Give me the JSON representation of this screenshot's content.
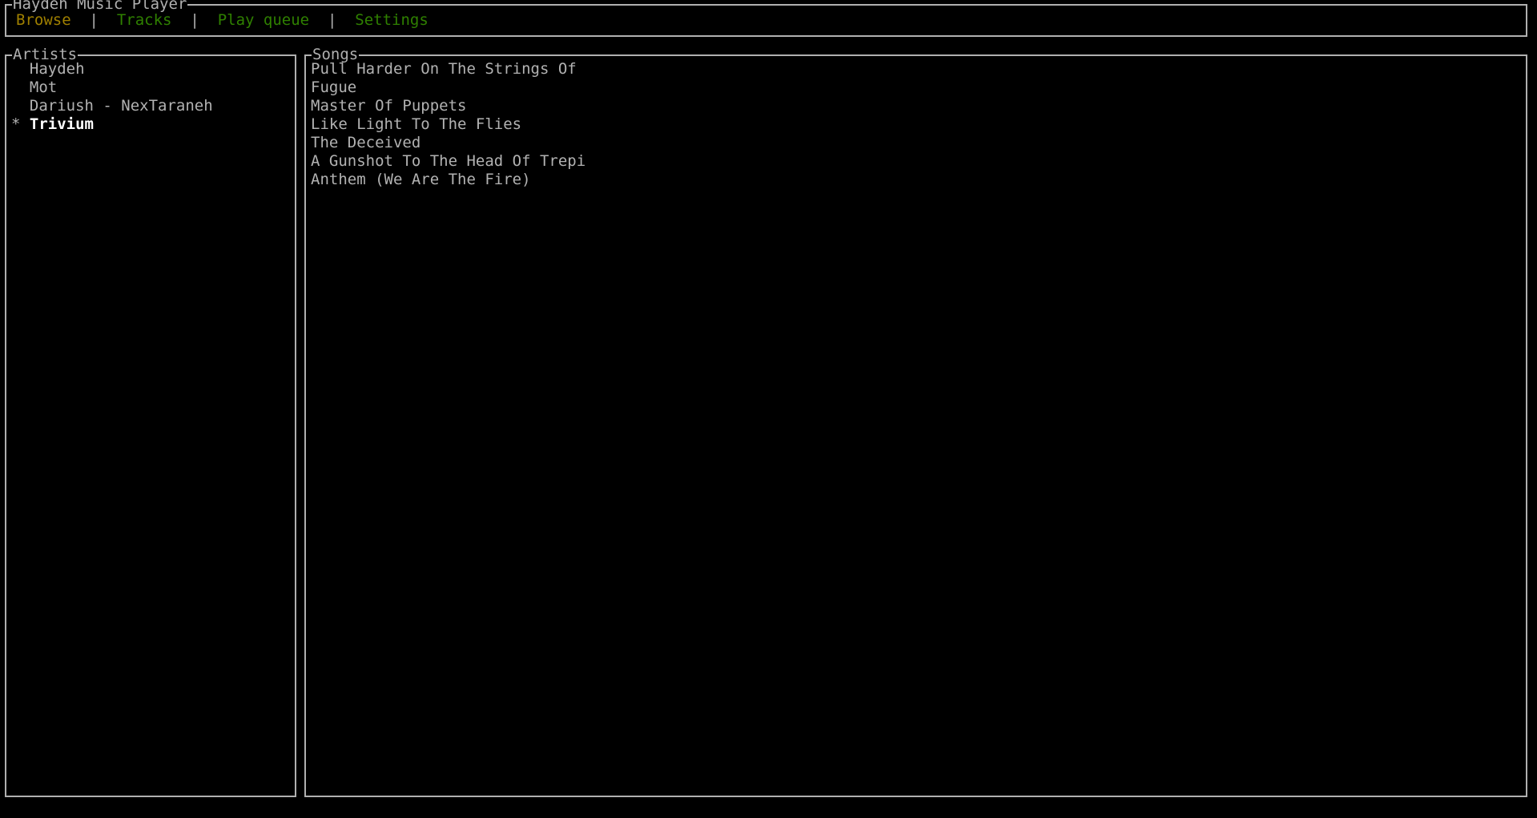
{
  "window": {
    "title": "Haydeh Music Player",
    "border_color": "#b0b0b0",
    "background": "#000000",
    "text_color": "#b2b2b2"
  },
  "menu": {
    "separator": "|",
    "active_color": "#a08000",
    "inactive_color": "#2f8000",
    "items": [
      {
        "label": "Browse",
        "state": "active"
      },
      {
        "label": "Tracks",
        "state": "normal"
      },
      {
        "label": "Play queue",
        "state": "normal"
      },
      {
        "label": "Settings",
        "state": "normal"
      }
    ]
  },
  "artists_pane": {
    "title": "Artists",
    "selected_marker": "*",
    "unselected_marker": " ",
    "items": [
      {
        "label": "Haydeh",
        "selected": false
      },
      {
        "label": "Mot",
        "selected": false
      },
      {
        "label": "Dariush - NexTaraneh",
        "selected": false
      },
      {
        "label": "Trivium",
        "selected": true
      }
    ]
  },
  "songs_pane": {
    "title": "Songs",
    "items": [
      {
        "label": "Pull Harder On The Strings Of"
      },
      {
        "label": "Fugue"
      },
      {
        "label": "Master Of Puppets"
      },
      {
        "label": "Like Light To The Flies"
      },
      {
        "label": "The Deceived"
      },
      {
        "label": "A Gunshot To The Head Of Trepi"
      },
      {
        "label": "Anthem (We Are The Fire)"
      }
    ]
  }
}
